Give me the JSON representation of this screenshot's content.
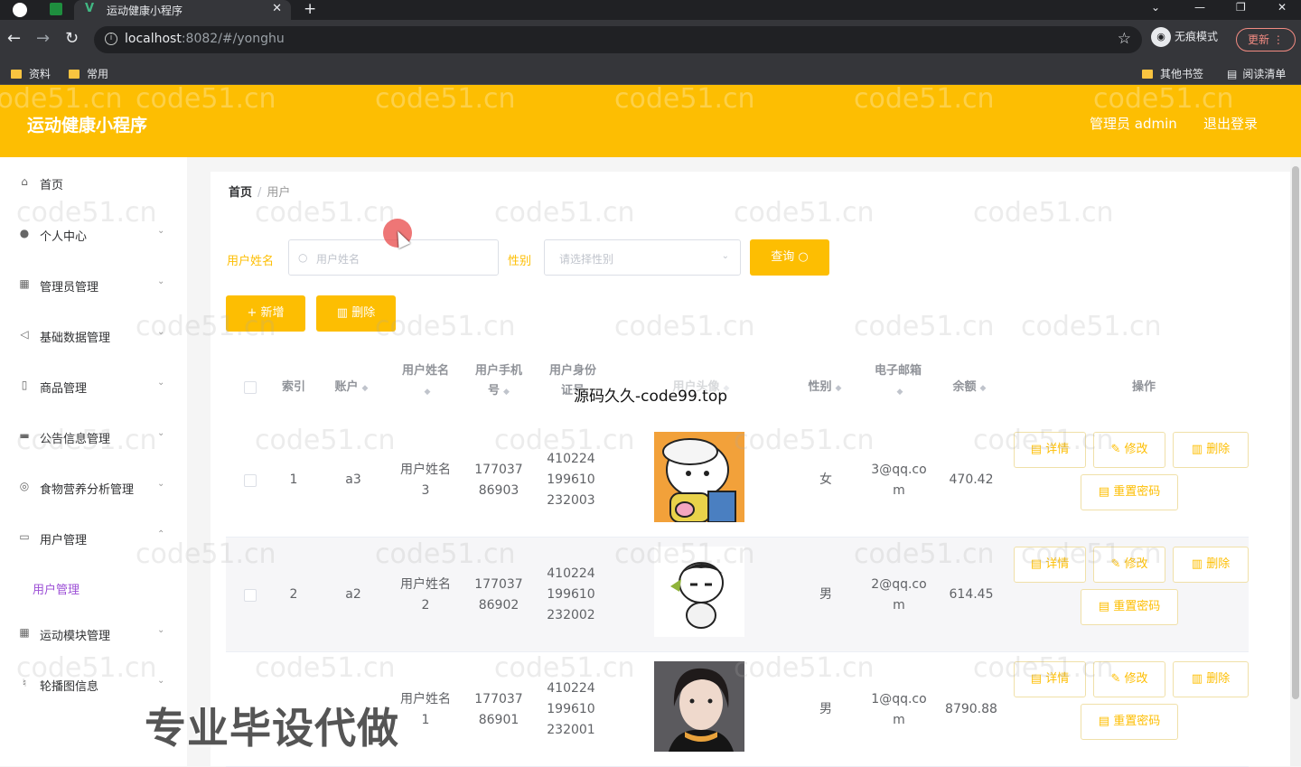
{
  "browser": {
    "tab_title": "运动健康小程序",
    "url_host": "localhost",
    "url_path": ":8082/#/yonghu",
    "incognito_label": "无痕模式",
    "update_label": "更新",
    "bookmarks": [
      "资料",
      "常用"
    ],
    "bookmarks_right": [
      "其他书签",
      "阅读清单"
    ]
  },
  "header": {
    "title": "运动健康小程序",
    "user_label": "管理员 admin",
    "logout_label": "退出登录",
    "accent": "#fdbe02"
  },
  "sidebar": {
    "items": [
      {
        "label": "首页",
        "icon": "home-icon"
      },
      {
        "label": "个人中心",
        "icon": "user-icon"
      },
      {
        "label": "管理员管理",
        "icon": "grid-icon"
      },
      {
        "label": "基础数据管理",
        "icon": "send-icon"
      },
      {
        "label": "商品管理",
        "icon": "phone-icon"
      },
      {
        "label": "公告信息管理",
        "icon": "briefcase-icon"
      },
      {
        "label": "食物营养分析管理",
        "icon": "compass-icon"
      },
      {
        "label": "用户管理",
        "icon": "chat-icon"
      },
      {
        "label": "运动模块管理",
        "icon": "apps-icon"
      },
      {
        "label": "轮播图信息",
        "icon": "mic-icon"
      }
    ],
    "active_sub": "用户管理"
  },
  "breadcrumb": {
    "home": "首页",
    "current": "用户"
  },
  "filters": {
    "name_label": "用户姓名",
    "name_placeholder": "用户姓名",
    "gender_label": "性别",
    "gender_placeholder": "请选择性别",
    "search_button": "查询"
  },
  "actions": {
    "add": "新增",
    "delete": "删除"
  },
  "table": {
    "headers": {
      "index": "索引",
      "account": "账户",
      "name": "用户姓名",
      "phone": "用户手机号",
      "idcard": "用户身份证号",
      "avatar": "用户头像",
      "gender": "性别",
      "email": "电子邮箱",
      "balance": "余额",
      "ops": "操作"
    },
    "rows": [
      {
        "index": "1",
        "account": "a3",
        "name": "用户姓名3",
        "phone": "17703786903",
        "idcard": "410224199610232003",
        "gender": "女",
        "email": "3@qq.com",
        "balance": "470.42"
      },
      {
        "index": "2",
        "account": "a2",
        "name": "用户姓名2",
        "phone": "17703786902",
        "idcard": "410224199610232002",
        "gender": "男",
        "email": "2@qq.com",
        "balance": "614.45"
      },
      {
        "index": "3",
        "account": "a1",
        "name": "用户姓名1",
        "phone": "17703786901",
        "idcard": "410224199610232001",
        "gender": "男",
        "email": "1@qq.com",
        "balance": "8790.88"
      }
    ],
    "op_labels": {
      "detail": "详情",
      "edit": "修改",
      "delete": "删除",
      "reset": "重置密码"
    }
  },
  "watermark": "code51.cn",
  "overlay": {
    "mid": "源码久久-code99.top",
    "bottom": "专业毕设代做"
  }
}
